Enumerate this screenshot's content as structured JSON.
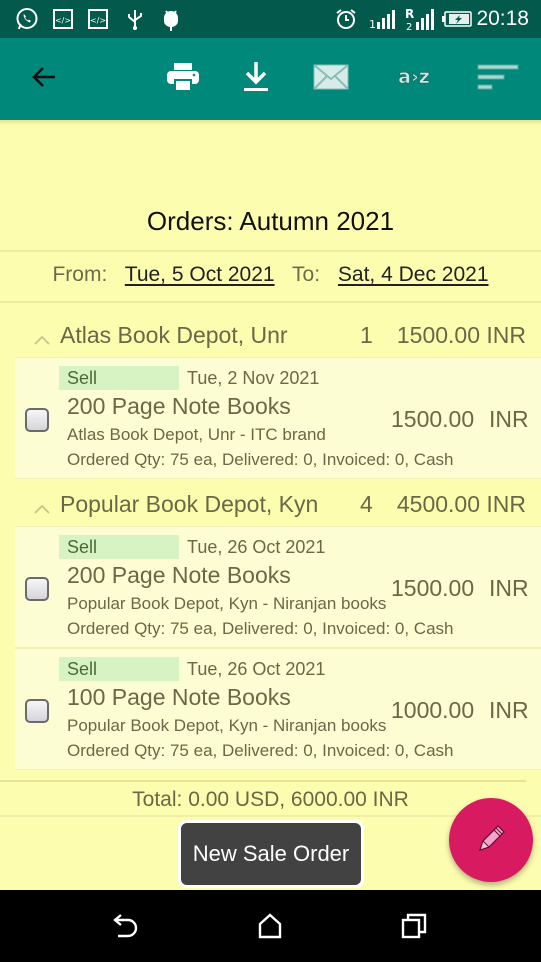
{
  "status_bar": {
    "time": "20:18",
    "left_icons": [
      "whatsapp-icon",
      "code-icon",
      "code-icon",
      "usb-icon",
      "android-debug-icon"
    ],
    "right_icons": [
      "alarm-icon",
      "signal-sim1-icon",
      "signal-roaming-sim2-icon",
      "battery-charging-icon"
    ],
    "signal_sim1_label": "1",
    "signal_sim2_label": "R",
    "signal_sim2_sub": "2"
  },
  "app_bar": {
    "back": "back-arrow-icon",
    "actions": [
      {
        "name": "print",
        "icon": "printer-icon"
      },
      {
        "name": "download",
        "icon": "download-icon"
      },
      {
        "name": "email",
        "icon": "mail-icon"
      },
      {
        "name": "sort-alpha",
        "icon": "sort-az-icon",
        "label": "a>z"
      },
      {
        "name": "sort",
        "icon": "sort-lines-icon"
      }
    ]
  },
  "page": {
    "title": "Orders: Autumn 2021",
    "from_label": "From:",
    "from_date": "Tue, 5 Oct 2021",
    "to_label": "To:",
    "to_date": "Sat, 4 Dec 2021"
  },
  "groups": [
    {
      "name": "Atlas Book Depot, Unr",
      "count": "1",
      "total": "1500.00 INR",
      "expanded": true,
      "items": [
        {
          "type": "Sell",
          "date": "Tue, 2 Nov 2021",
          "product": "200 Page Note Books",
          "customer": "Atlas Book Depot, Unr - ITC brand",
          "details": "Ordered Qty: 75 ea, Delivered: 0, Invoiced: 0, Cash",
          "amount": "1500.00",
          "currency": "INR",
          "checked": false
        }
      ]
    },
    {
      "name": "Popular Book Depot, Kyn",
      "count": "4",
      "total": "4500.00 INR",
      "expanded": true,
      "items": [
        {
          "type": "Sell",
          "date": "Tue, 26 Oct 2021",
          "product": "200 Page Note Books",
          "customer": "Popular Book Depot, Kyn - Niranjan books",
          "details": "Ordered Qty: 75 ea, Delivered: 0, Invoiced: 0, Cash",
          "amount": "1500.00",
          "currency": "INR",
          "checked": false
        },
        {
          "type": "Sell",
          "date": "Tue, 26 Oct 2021",
          "product": "100 Page Note Books",
          "customer": "Popular Book Depot, Kyn - Niranjan books",
          "details": "Ordered Qty: 75 ea, Delivered: 0, Invoiced: 0, Cash",
          "amount": "1000.00",
          "currency": "INR",
          "checked": false
        }
      ]
    }
  ],
  "footer": {
    "total": "Total: 0.00 USD, 6000.00 INR",
    "new_order_button": "New Sale Order",
    "fab_icon": "pencil-icon"
  },
  "nav_bar": {
    "buttons": [
      "back-icon",
      "home-icon",
      "recents-icon"
    ]
  },
  "colors": {
    "status_bar": "#02594c",
    "app_bar": "#00897b",
    "background": "#fdfdb0",
    "item_background": "#fdfdd3",
    "tag_background": "#d7f3c4",
    "fab": "#d81b60",
    "snackbar": "#424242"
  }
}
